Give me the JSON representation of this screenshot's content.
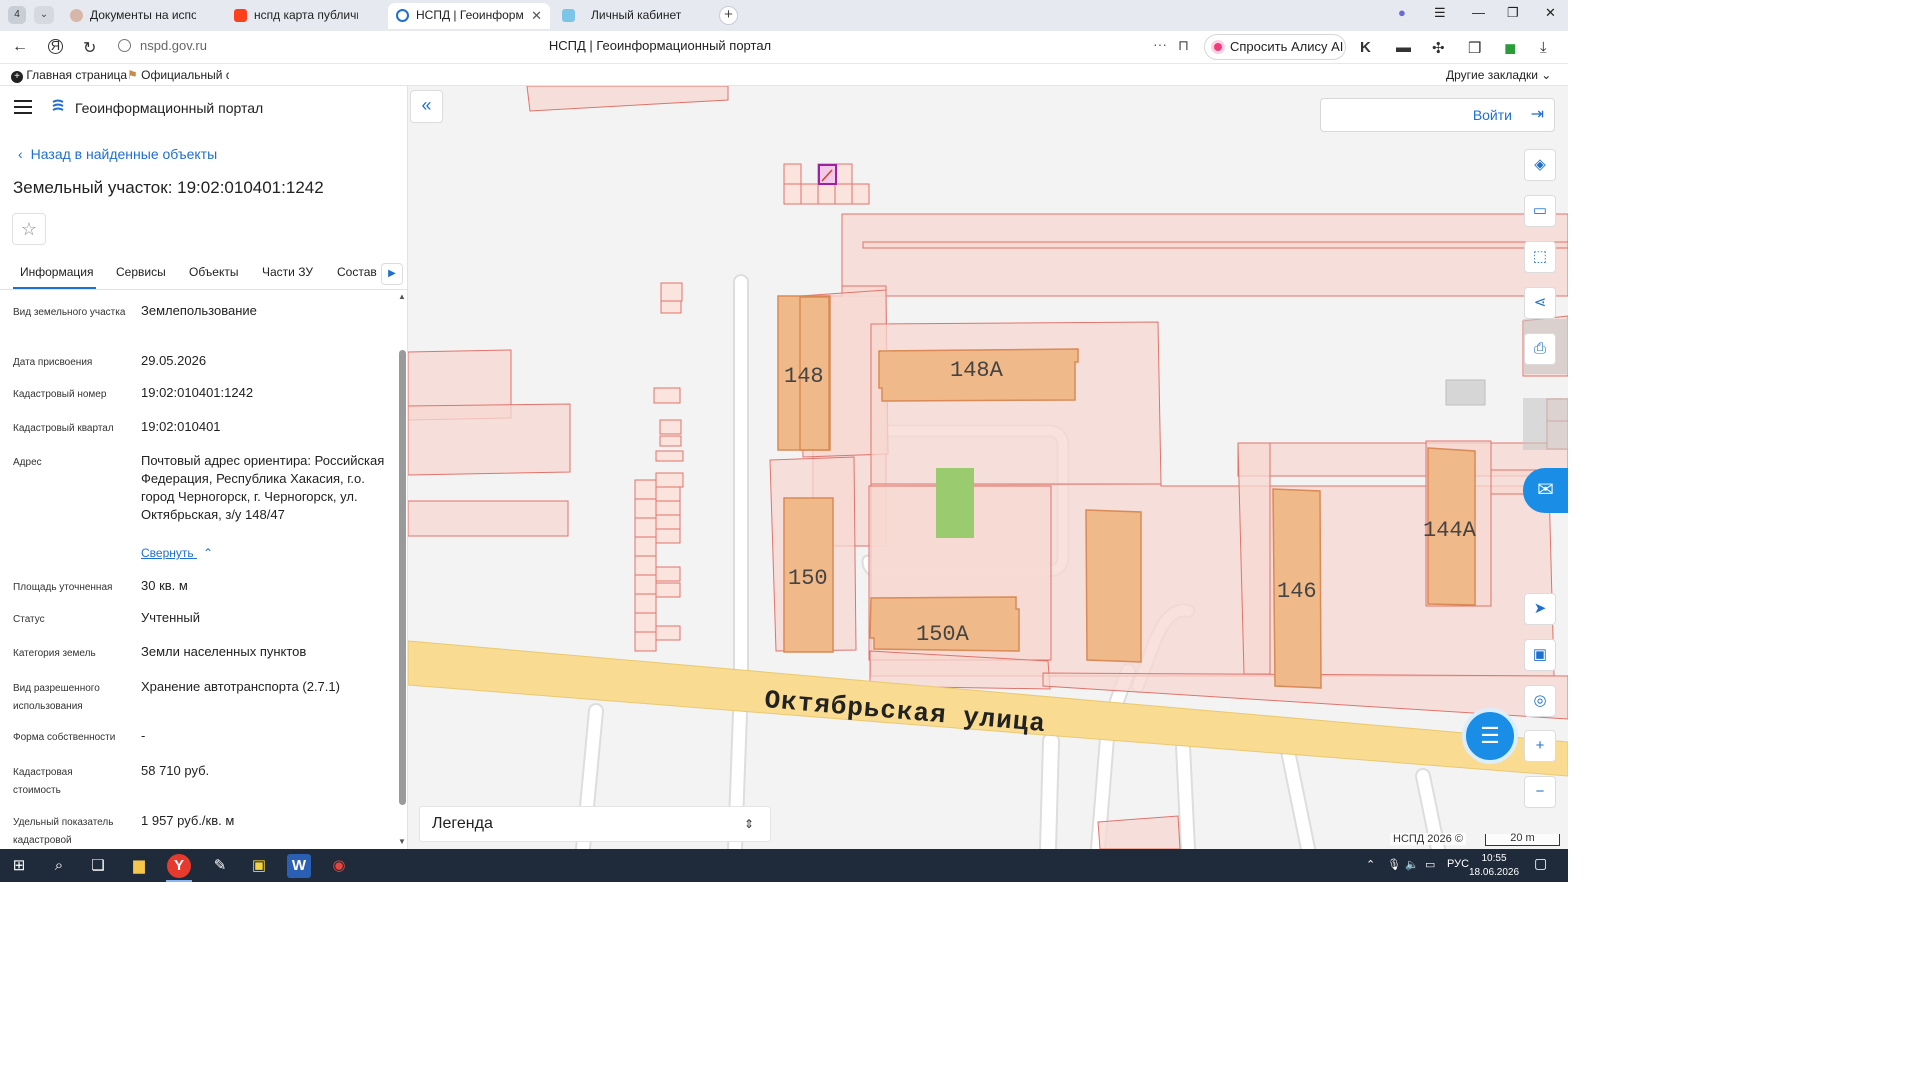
{
  "browser": {
    "tab_count": "4",
    "tabs": [
      {
        "title": "Документы на исполнение",
        "icon": "document-favicon-icon"
      },
      {
        "title": "нспд карта публичная кадастровая",
        "icon": "yandex-favicon-icon"
      },
      {
        "title": "НСПД | Геоинформационный портал",
        "icon": "nspd-favicon-icon"
      },
      {
        "title": "Личный кабинет",
        "icon": "gosuslugi-favicon-icon"
      }
    ],
    "url": "nspd.gov.ru",
    "page_title": "НСПД | Геоинформационный портал",
    "alice_label": "Спросить Алису AI",
    "bookmarks": [
      {
        "label": "Главная страница",
        "icon": "add-bookmark-icon"
      },
      {
        "label": "Официальный сайт",
        "icon": "flag-icon"
      }
    ],
    "other_bookmarks": "Другие закладки"
  },
  "sidebar": {
    "portal_title": "Геоинформационный портал",
    "back_label": "Назад в найденные объекты",
    "object_title": "Земельный участок: 19:02:010401:1242",
    "tabs": [
      "Информация",
      "Сервисы",
      "Объекты",
      "Части ЗУ",
      "Состав"
    ],
    "properties": [
      {
        "label": "Вид земельного участка",
        "value": "Землепользование"
      },
      {
        "label": "Дата присвоения",
        "value": "29.05.2026"
      },
      {
        "label": "Кадастровый номер",
        "value": "19:02:010401:1242"
      },
      {
        "label": "Кадастровый квартал",
        "value": "19:02:010401"
      },
      {
        "label": "Адрес",
        "value": "Почтовый адрес ориентира: Российская Федерация, Республика Хакасия, г.о. город Черногорск, г. Черногорск, ул. Октябрьская, з/у 148/47"
      },
      {
        "label": "Площадь уточненная",
        "value": "30 кв. м"
      },
      {
        "label": "Статус",
        "value": "Учтенный"
      },
      {
        "label": "Категория земель",
        "value": "Земли населенных пунктов"
      },
      {
        "label": "Вид разрешенного использования",
        "value": "Хранение автотранспорта (2.7.1)"
      },
      {
        "label": "Форма собственности",
        "value": "-"
      },
      {
        "label": "Кадастровая стоимость",
        "value": "58 710 руб."
      },
      {
        "label": "Удельный показатель кадастровой",
        "value": "1 957 руб./кв. м"
      }
    ],
    "collapse_label": "Свернуть"
  },
  "map": {
    "login_label": "Войти",
    "building_labels": [
      "148",
      "148А",
      "150",
      "150А",
      "146",
      "144А"
    ],
    "street_label": "Октябрьская улица",
    "legend_label": "Легенда",
    "copyright": "НСПД 2026 ©",
    "scale_label": "20 m",
    "colors": {
      "parcel": "#f7d8d2",
      "parcel_stroke": "#e0736b",
      "building": "#f0b98a",
      "street": "#f9dc91",
      "selected": "#a020a0"
    }
  },
  "taskbar": {
    "lang": "РУС",
    "time": "10:55",
    "date": "18.06.2026"
  }
}
